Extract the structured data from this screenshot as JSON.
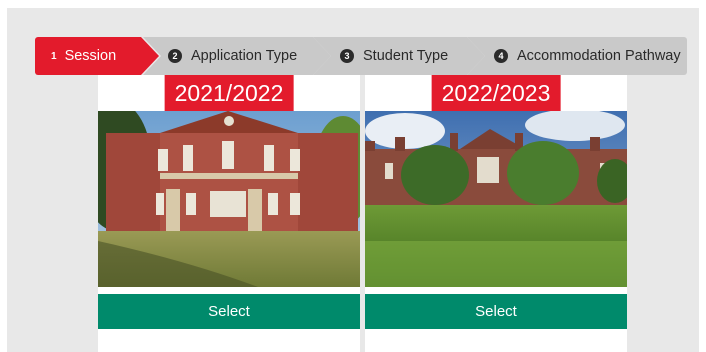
{
  "stepper": {
    "steps": [
      {
        "number": "1",
        "label": "Session",
        "active": true
      },
      {
        "number": "2",
        "label": "Application Type",
        "active": false
      },
      {
        "number": "3",
        "label": "Student Type",
        "active": false
      },
      {
        "number": "4",
        "label": "Accommodation Pathway",
        "active": false
      }
    ]
  },
  "sessions": [
    {
      "year": "2021/2022",
      "button_label": "Select",
      "photo": "red-brick-hall-with-lawn-photo"
    },
    {
      "year": "2022/2023",
      "button_label": "Select",
      "photo": "campus-building-across-grass-photo"
    }
  ],
  "colors": {
    "accent_red": "#e31b2c",
    "select_green": "#008a6b",
    "step_inactive": "#c9c9c9",
    "background": "#e8e8e8"
  }
}
